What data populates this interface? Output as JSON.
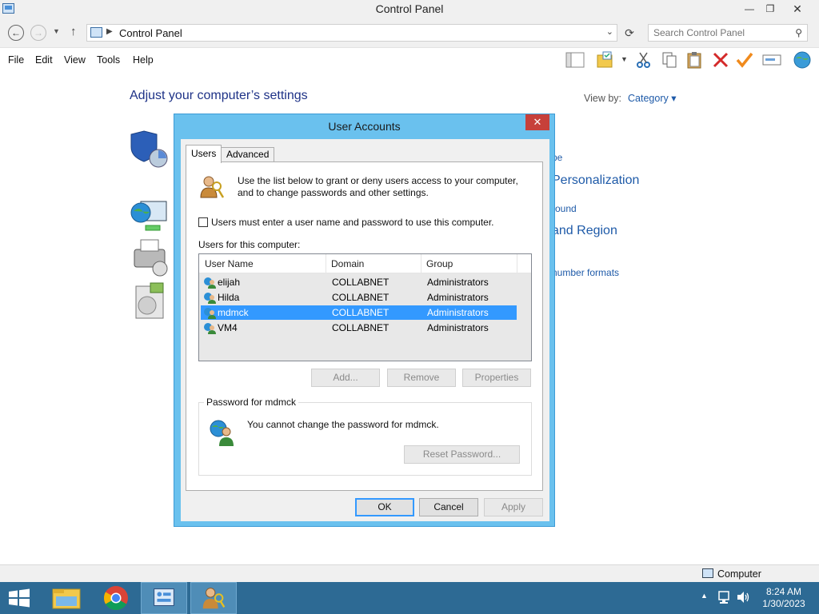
{
  "window": {
    "title": "Control Panel"
  },
  "address": {
    "path": "Control Panel",
    "search_placeholder": "Search Control Panel"
  },
  "menu": [
    "File",
    "Edit",
    "View",
    "Tools",
    "Help"
  ],
  "control_panel": {
    "heading": "Adjust your computer’s settings",
    "view_by_label": "View by:",
    "view_by_value": "Category ▾",
    "partial_texts": {
      "link1": "pe",
      "cat1": "Personalization",
      "link2": "round",
      "cat2": "and Region",
      "link3": "number formats"
    }
  },
  "dialog": {
    "title": "User Accounts",
    "close": "✕",
    "tabs": [
      "Users",
      "Advanced"
    ],
    "intro": "Use the list below to grant or deny users access to your computer, and to change passwords and other settings.",
    "checkbox_label": "Users must enter a user name and password to use this computer.",
    "checkbox_checked": false,
    "users_label": "Users for this computer:",
    "columns": [
      "User Name",
      "Domain",
      "Group"
    ],
    "users": [
      {
        "name": "elijah",
        "domain": "COLLABNET",
        "group": "Administrators"
      },
      {
        "name": "Hilda",
        "domain": "COLLABNET",
        "group": "Administrators"
      },
      {
        "name": "mdmck",
        "domain": "COLLABNET",
        "group": "Administrators"
      },
      {
        "name": "VM4",
        "domain": "COLLABNET",
        "group": "Administrators"
      }
    ],
    "selected_user": "mdmck",
    "buttons": {
      "add": "Add...",
      "remove": "Remove",
      "properties": "Properties"
    },
    "password_group_label": "Password for mdmck",
    "password_text": "You cannot change the password for mdmck.",
    "reset_password": "Reset Password...",
    "footer": {
      "ok": "OK",
      "cancel": "Cancel",
      "apply": "Apply"
    }
  },
  "statusbar": {
    "location": "Computer"
  },
  "taskbar": {
    "time": "8:24 AM",
    "date": "1/30/2023"
  }
}
